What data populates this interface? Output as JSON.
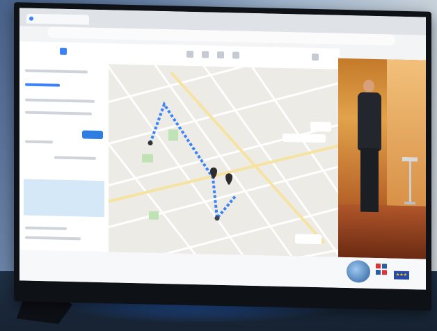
{
  "scene": {
    "description_type": "photo-of-monitor",
    "colors": {
      "map_bg": "#ecebe6",
      "route": "#3b82f6",
      "sidebar_accent": "#2f7de1",
      "video_warm": "#e2a24a"
    },
    "icons": [
      "browser-tab-icon",
      "map-pin-icon",
      "route-dot-icon",
      "logo-icon",
      "eu-flag-icon"
    ]
  }
}
